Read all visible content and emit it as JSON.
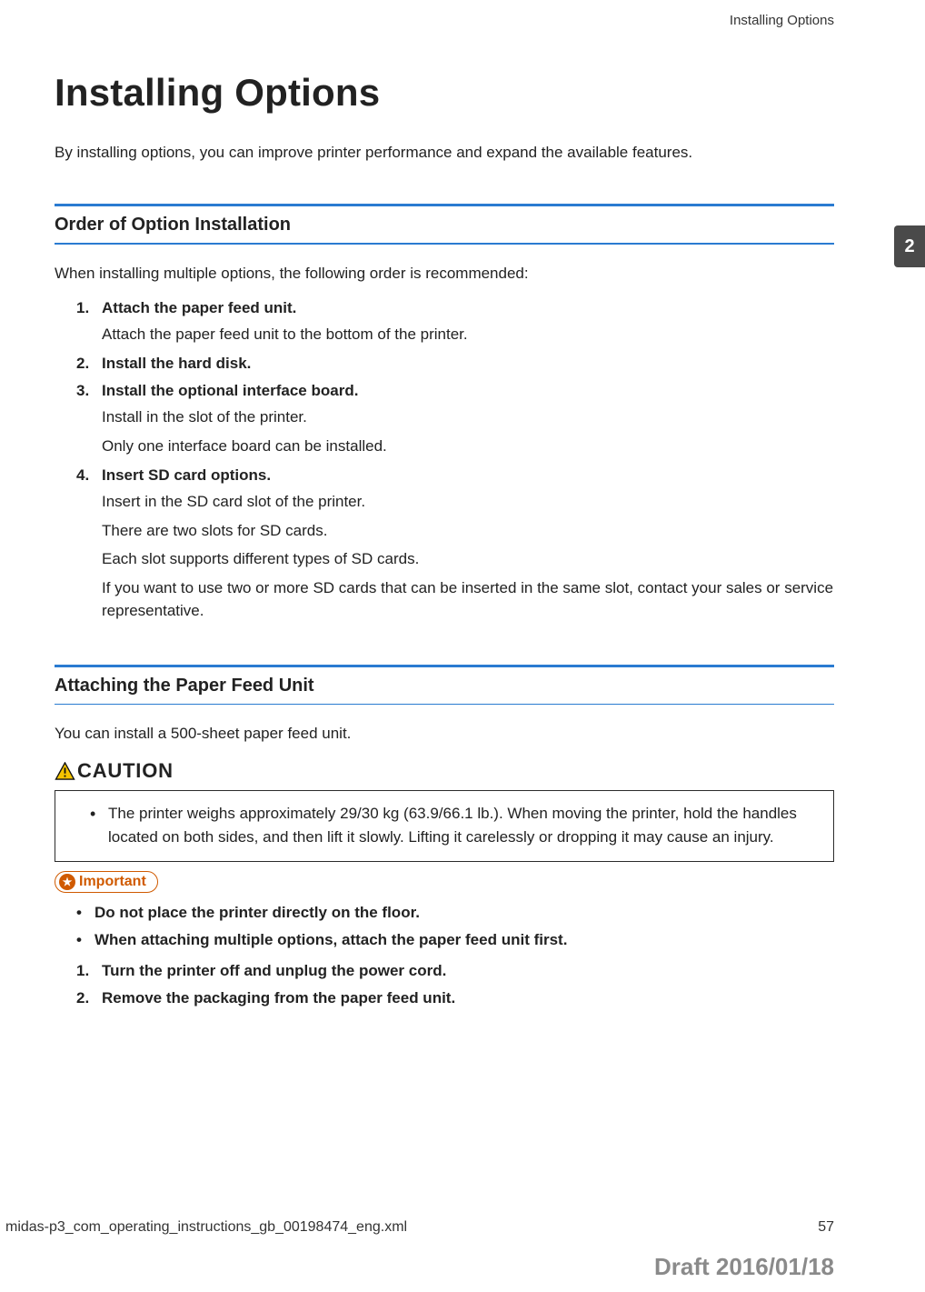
{
  "runningHead": "Installing Options",
  "chapterTab": "2",
  "title": "Installing Options",
  "intro": "By installing options, you can improve printer performance and expand the available features.",
  "section1": {
    "heading": "Order of Option Installation",
    "lead": "When installing multiple options, the following order is recommended:",
    "items": [
      {
        "num": "1.",
        "title": "Attach the paper feed unit.",
        "subs": [
          "Attach the paper feed unit to the bottom of the printer."
        ]
      },
      {
        "num": "2.",
        "title": "Install the hard disk.",
        "subs": []
      },
      {
        "num": "3.",
        "title": "Install the optional interface board.",
        "subs": [
          "Install in the slot of the printer.",
          "Only one interface board can be installed."
        ]
      },
      {
        "num": "4.",
        "title": "Insert SD card options.",
        "subs": [
          "Insert in the SD card slot of the printer.",
          "There are two slots for SD cards.",
          "Each slot supports different types of SD cards.",
          "If you want to use two or more SD cards that can be inserted in the same slot, contact your sales or service representative."
        ]
      }
    ]
  },
  "section2": {
    "heading": "Attaching the Paper Feed Unit",
    "lead": "You can install a 500-sheet paper feed unit.",
    "cautionLabel": "CAUTION",
    "cautionItems": [
      "The printer weighs approximately 29/30 kg (63.9/66.1 lb.). When moving the printer, hold the handles located on both sides, and then lift it slowly. Lifting it carelessly or dropping it may cause an injury."
    ],
    "importantLabel": "Important",
    "importantItems": [
      "Do not place the printer directly on the floor.",
      "When attaching multiple options, attach the paper feed unit first."
    ],
    "steps": [
      {
        "num": "1.",
        "title": "Turn the printer off and unplug the power cord."
      },
      {
        "num": "2.",
        "title": "Remove the packaging from the paper feed unit."
      }
    ]
  },
  "footer": {
    "left": "midas-p3_com_operating_instructions_gb_00198474_eng.xml",
    "right": "57"
  },
  "draftStamp": "Draft 2016/01/18"
}
